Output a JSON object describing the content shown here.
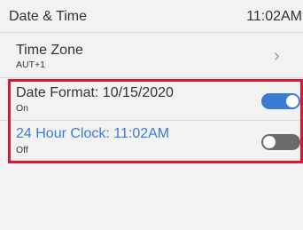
{
  "header": {
    "title": "Date & Time",
    "time": "11:02AM"
  },
  "rows": [
    {
      "title": "Time Zone",
      "subtitle": "AUT+1",
      "chevron": "›"
    },
    {
      "title": "Date Format: 10/15/2020",
      "subtitle": "On",
      "toggle_state": "on"
    },
    {
      "title": "24 Hour Clock: 11:02AM",
      "subtitle": "Off",
      "toggle_state": "off"
    }
  ],
  "colors": {
    "accent": "#3a7bd5",
    "toggle_off": "#6b6b6b",
    "highlight": "#e8112d",
    "background": "#f2f2f2"
  }
}
